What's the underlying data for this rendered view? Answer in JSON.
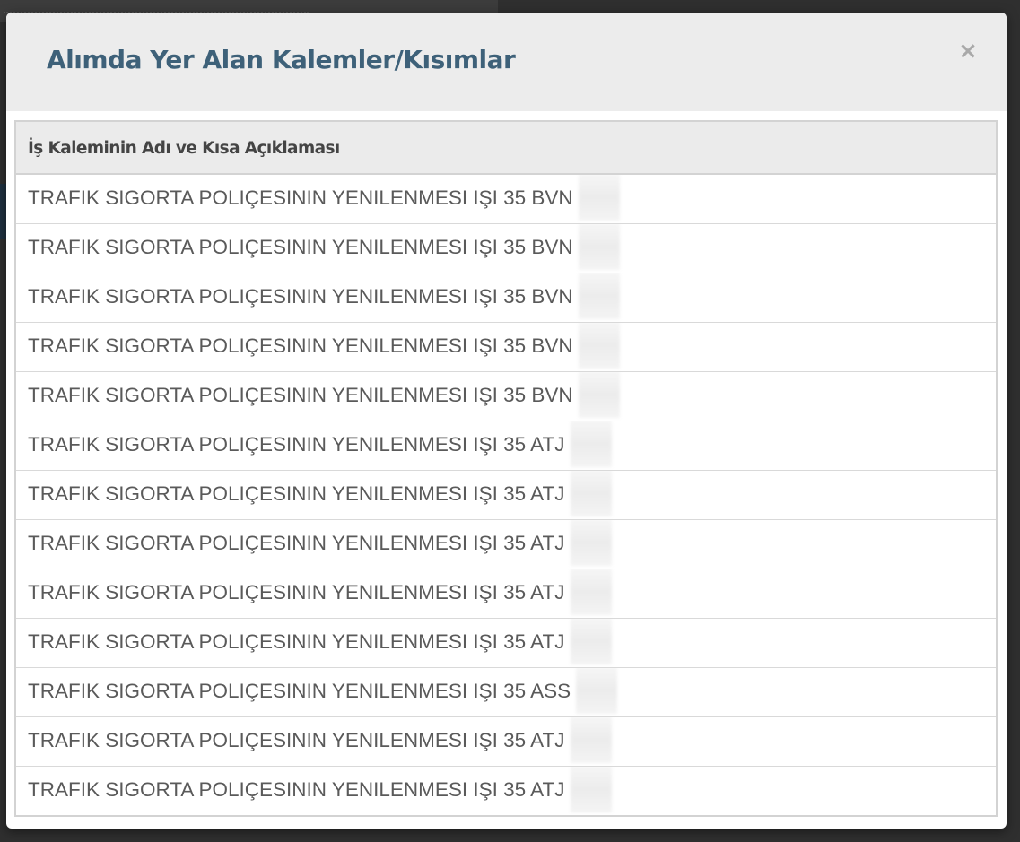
{
  "modal": {
    "title": "Alımda Yer Alan Kalemler/Kısımlar",
    "close_label": "×"
  },
  "table": {
    "headers": [
      "İş Kaleminin Adı ve Kısa Açıklaması"
    ],
    "rows": [
      "TRAFIK SIGORTA POLIÇESININ YENILENMESI IŞI 35 BVN",
      "TRAFIK SIGORTA POLIÇESININ YENILENMESI IŞI 35 BVN",
      "TRAFIK SIGORTA POLIÇESININ YENILENMESI IŞI 35 BVN",
      "TRAFIK SIGORTA POLIÇESININ YENILENMESI IŞI 35 BVN",
      "TRAFIK SIGORTA POLIÇESININ YENILENMESI IŞI 35 BVN",
      "TRAFIK SIGORTA POLIÇESININ YENILENMESI IŞI 35 ATJ",
      "TRAFIK SIGORTA POLIÇESININ YENILENMESI IŞI 35 ATJ",
      "TRAFIK SIGORTA POLIÇESININ YENILENMESI IŞI 35 ATJ",
      "TRAFIK SIGORTA POLIÇESININ YENILENMESI IŞI 35 ATJ",
      "TRAFIK SIGORTA POLIÇESININ YENILENMESI IŞI 35 ATJ",
      "TRAFIK SIGORTA POLIÇESININ YENILENMESI IŞI 35 ASS",
      "TRAFIK SIGORTA POLIÇESININ YENILENMESI IŞI 35 ATJ",
      "TRAFIK SIGORTA POLIÇESININ YENILENMESI IŞI 35 ATJ"
    ]
  },
  "colors": {
    "title": "#3e6179",
    "header_background": "#ececec",
    "close_icon": "#a9a9a9",
    "row_text": "#5a5a5a"
  },
  "icons": {
    "close": "close-icon"
  }
}
